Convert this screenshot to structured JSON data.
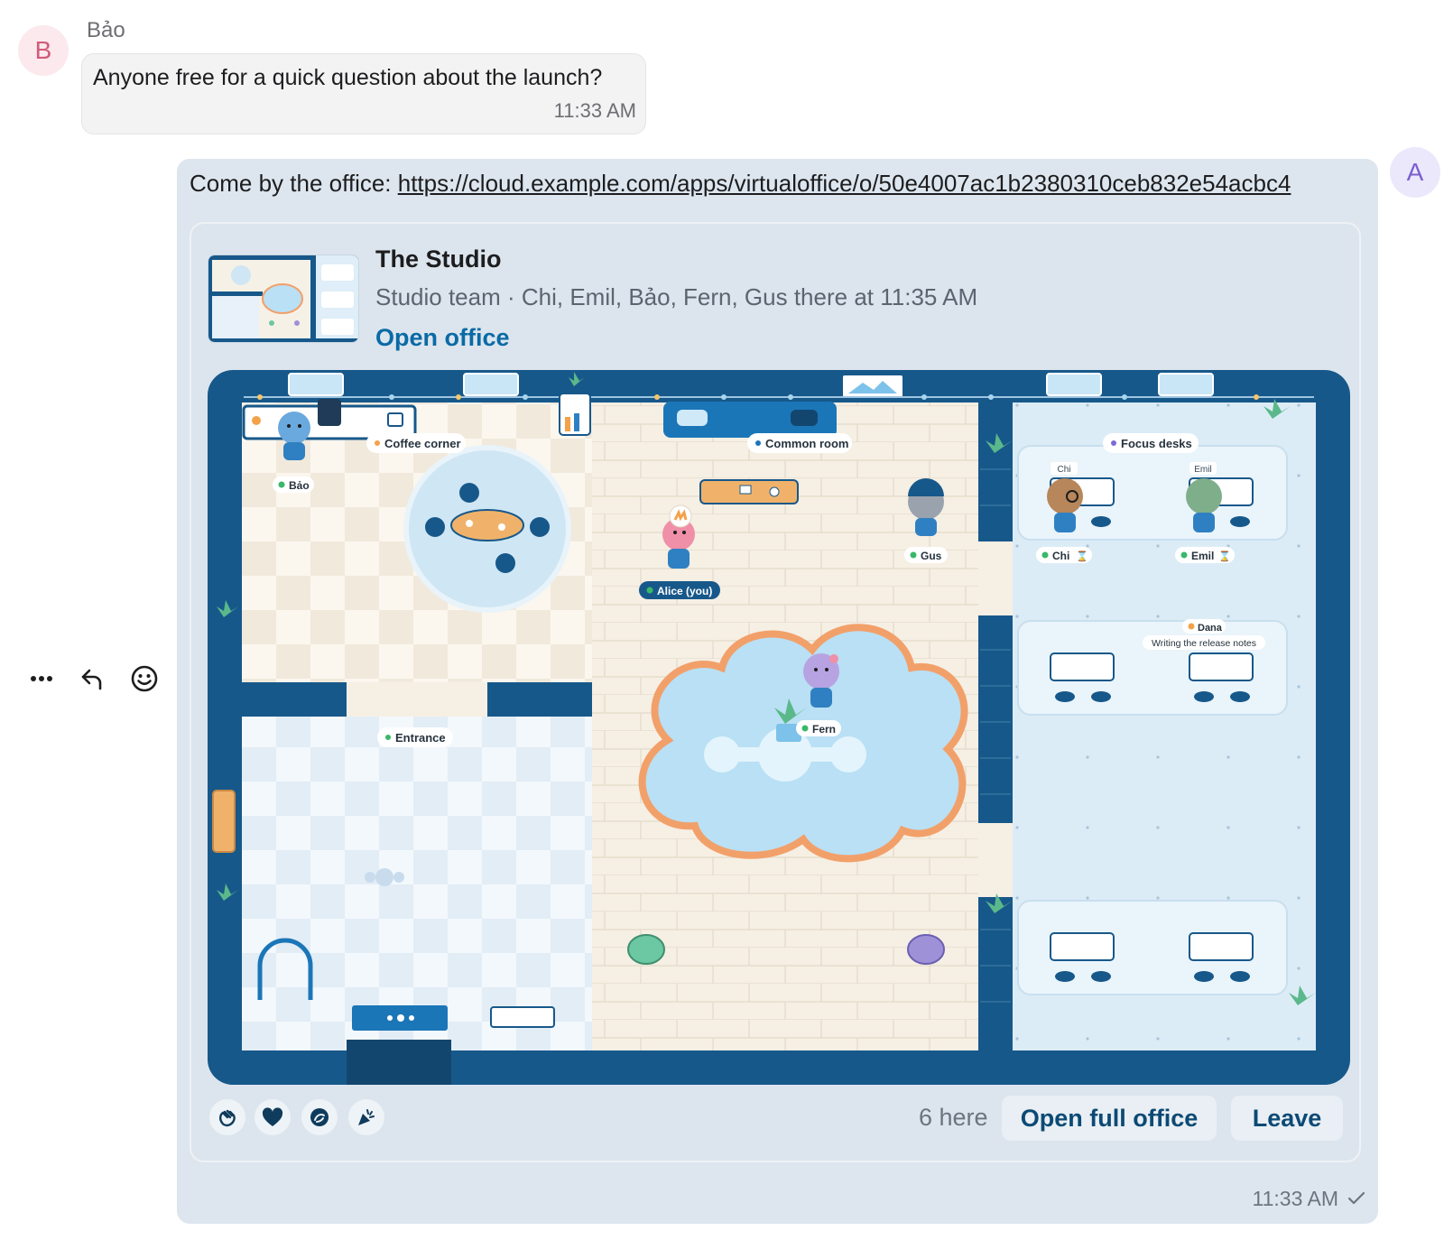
{
  "incoming": {
    "avatar_letter": "B",
    "sender": "Bảo",
    "text": "Anyone free for a quick question about the launch?",
    "time": "11:33 AM"
  },
  "outgoing": {
    "avatar_letter": "A",
    "intro": "Come by the office: ",
    "link": "https://cloud.example.com/apps/virtualoffice/o/50e4007ac1b2380310ceb832e54acbc4",
    "time": "11:33 AM"
  },
  "card": {
    "title": "The Studio",
    "subtitle": "Studio team · Chi, Emil, Bảo, Fern, Gus there at 11:35 AM",
    "open_link": "Open office"
  },
  "map": {
    "rooms": {
      "coffee": "Coffee corner",
      "common": "Common room",
      "focus": "Focus desks",
      "entrance": "Entrance"
    },
    "people": {
      "bao": "Bảo",
      "alice": "Alice (you)",
      "gus": "Gus",
      "chi": "Chi",
      "emil": "Emil",
      "dana": "Dana",
      "fern": "Fern",
      "chi_tag": "Chi",
      "emil_tag": "Emil"
    },
    "dana_status": "Writing the release notes",
    "colors": {
      "presence_green": "#39b86a",
      "presence_orange": "#f3a24a",
      "presence_purple": "#7b6bd6",
      "wall": "#17588a"
    }
  },
  "footer": {
    "reactions": [
      "wave-icon",
      "heart-icon",
      "sparkle-icon",
      "party-icon"
    ],
    "here_count": "6 here",
    "open_full": "Open full office",
    "leave": "Leave"
  },
  "hover_actions": [
    "more-icon",
    "reply-icon",
    "emoji-icon"
  ]
}
